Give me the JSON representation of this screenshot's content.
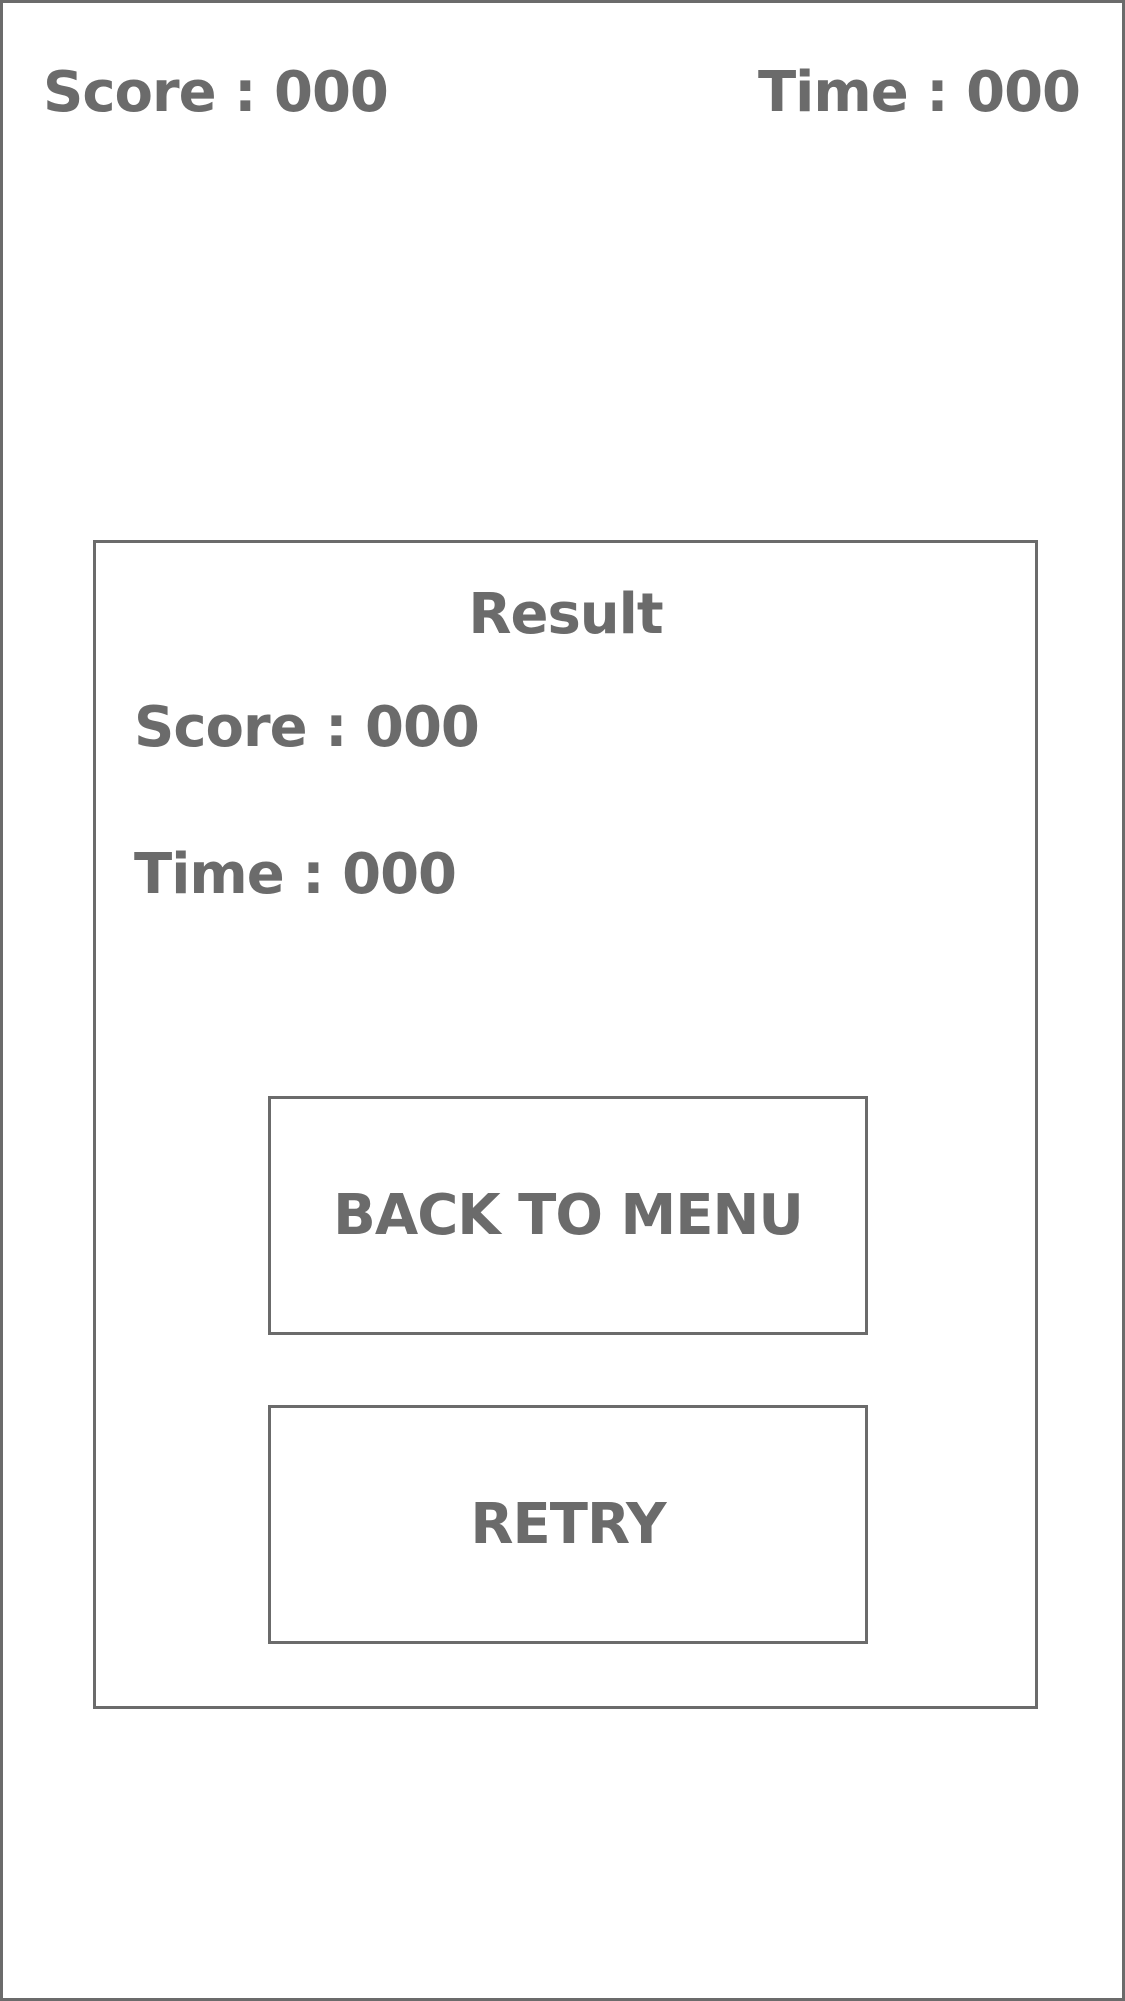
{
  "hud": {
    "score_label": "Score : 000",
    "time_label": "Time : 000"
  },
  "result_panel": {
    "title": "Result",
    "score_label": "Score : 000",
    "time_label": "Time : 000",
    "back_to_menu_label": "BACK TO MENU",
    "retry_label": "RETRY"
  },
  "colors": {
    "foreground": "#6b6b6b",
    "background": "#ffffff"
  }
}
